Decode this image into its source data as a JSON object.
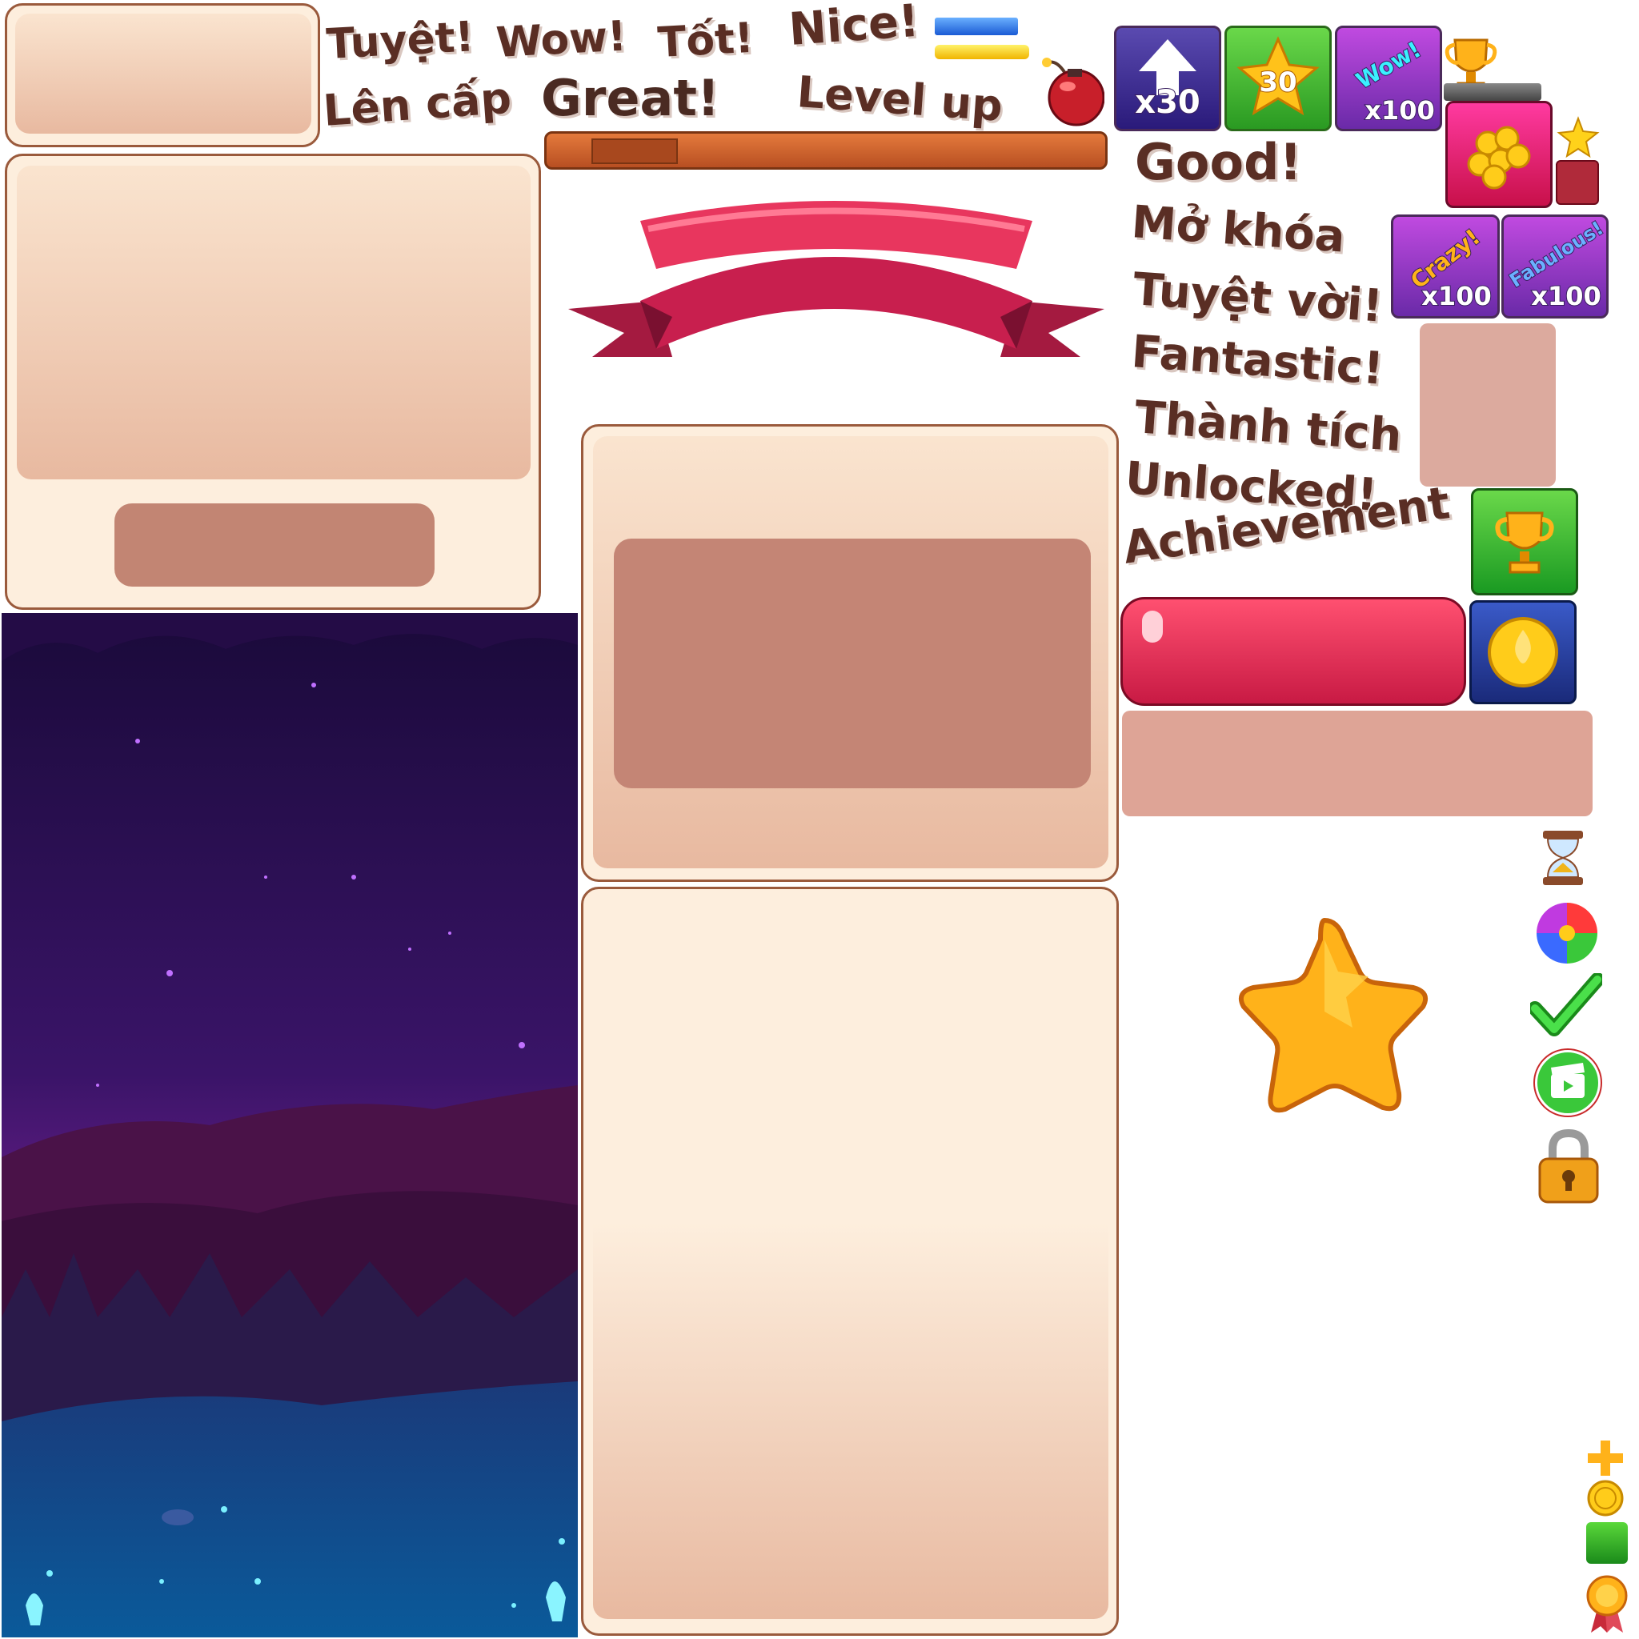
{
  "words": {
    "tuyet": "Tuyệt!",
    "wow": "Wow!",
    "tot": "Tốt!",
    "nice": "Nice!",
    "len_cap": "Lên cấp",
    "great": "Great!",
    "level_up": "Level up",
    "good": "Good!",
    "mo_khoa": "Mở khóa",
    "tuyet_voi": "Tuyệt vời!",
    "fantastic": "Fantastic!",
    "thanh_tich": "Thành tích",
    "unlocked": "Unlocked!",
    "achievement": "Achievement"
  },
  "tiles": {
    "arrow_count": "x30",
    "star_count": "30",
    "wow_label": "Wow!",
    "wow_count": "x100",
    "crazy_label": "Crazy!",
    "crazy_count": "x100",
    "fabulous_label": "Fabulous!",
    "fabulous_count": "x100"
  },
  "icons": [
    "bomb-icon",
    "trophy-icon",
    "coins-icon",
    "star-icon",
    "hourglass-icon",
    "color-wheel-icon",
    "checkmark-icon",
    "video-clapper-icon",
    "padlock-icon",
    "plus-icon",
    "coin-icon",
    "green-square-icon",
    "medal-icon",
    "gold-coin-icon",
    "ribbon-banner",
    "big-star-icon"
  ],
  "colors": {
    "parchment": "#fdeedd",
    "parchment_border": "#9a5a3c",
    "ribbon": "#d42a56",
    "red_button": "#d8344f",
    "night_sky": "#2a1050"
  }
}
